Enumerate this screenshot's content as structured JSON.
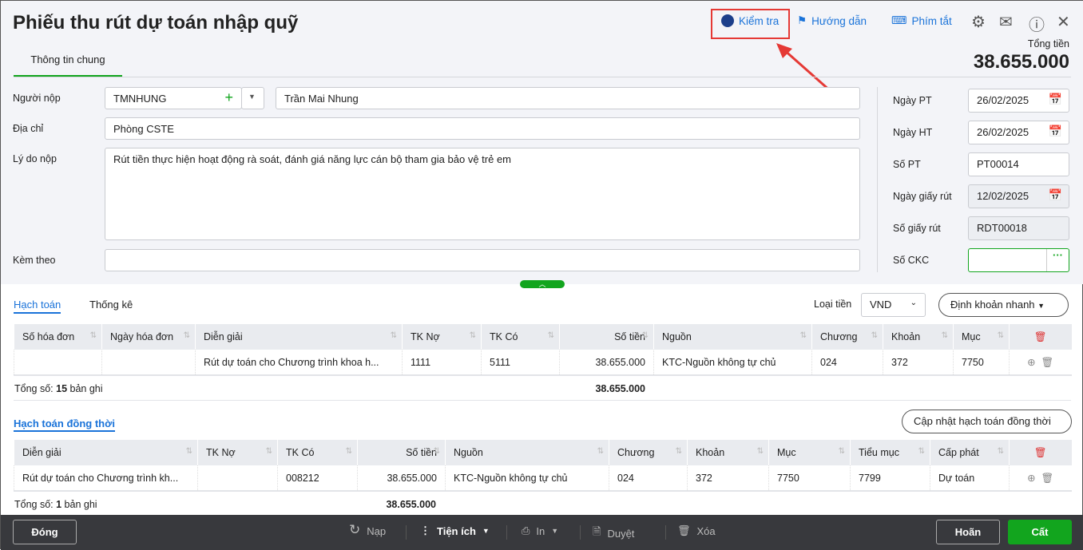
{
  "header": {
    "title": "Phiếu thu rút dự toán nhập quỹ",
    "check": "Kiểm tra",
    "guide": "Hướng dẫn",
    "shortcuts": "Phím tắt",
    "total_label": "Tổng tiền",
    "total": "38.655.000",
    "tab": "Thông tin chung"
  },
  "form": {
    "payer_label": "Người nộp",
    "payer_code": "TMNHUNG",
    "payer_name": "Trần Mai Nhung",
    "address_label": "Địa chỉ",
    "address": "Phòng CSTE",
    "reason_label": "Lý do nộp",
    "reason": "Rút tiền thực hiện hoạt động rà soát, đánh giá năng lực cán bộ tham gia bảo vệ trẻ em",
    "attach_label": "Kèm theo",
    "attach": "",
    "right": [
      {
        "label": "Ngày PT",
        "value": "26/02/2025",
        "cal": true,
        "dis": false
      },
      {
        "label": "Ngày HT",
        "value": "26/02/2025",
        "cal": true,
        "dis": false
      },
      {
        "label": "Số PT",
        "value": "PT00014",
        "cal": false,
        "dis": false
      },
      {
        "label": "Ngày giấy rút",
        "value": "12/02/2025",
        "cal": true,
        "dis": true
      },
      {
        "label": "Số giấy rút",
        "value": "RDT00018",
        "cal": false,
        "dis": true
      },
      {
        "label": "Số CKC",
        "value": "",
        "cal": false,
        "dis": false
      }
    ]
  },
  "section1": {
    "tab1": "Hạch toán",
    "tab2": "Thống kê",
    "currency_label": "Loại tiền",
    "currency": "VND",
    "quick": "Định khoản nhanh",
    "columns": [
      "Số hóa đơn",
      "Ngày hóa đơn",
      "Diễn giải",
      "TK Nợ",
      "TK Có",
      "Số tiền",
      "Nguồn",
      "Chương",
      "Khoản",
      "Mục"
    ],
    "rows": [
      [
        "",
        "",
        "Rút dự toán cho Chương trình khoa h...",
        "1111",
        "5111",
        "38.655.000",
        "KTC-Nguồn không tự chủ",
        "024",
        "372",
        "7750"
      ]
    ],
    "total_prefix": "Tổng số: ",
    "total_count": "15",
    "total_suffix": " bản ghi",
    "total_amount": "38.655.000"
  },
  "section2": {
    "title": "Hạch toán đồng thời",
    "update": "Cập nhật hạch toán đồng thời",
    "columns": [
      "Diễn giải",
      "TK Nợ",
      "TK Có",
      "Số tiền",
      "Nguồn",
      "Chương",
      "Khoản",
      "Mục",
      "Tiểu mục",
      "Cấp phát"
    ],
    "rows": [
      [
        "Rút dự toán cho Chương trình kh...",
        "",
        "008212",
        "38.655.000",
        "KTC-Nguồn không tự chủ",
        "024",
        "372",
        "7750",
        "7799",
        "Dự toán"
      ]
    ],
    "total_prefix": "Tổng số: ",
    "total_count": "1",
    "total_suffix": " bản ghi",
    "total_amount": "38.655.000"
  },
  "footer": {
    "close": "Đóng",
    "reload": "Nạp",
    "utils": "Tiện ích",
    "print": "In",
    "approve": "Duyệt",
    "delete": "Xóa",
    "cancel": "Hoãn",
    "save": "Cất"
  },
  "colors": {
    "accent": "#1a73d9",
    "green": "#12a51e",
    "highlight": "#e53935"
  }
}
